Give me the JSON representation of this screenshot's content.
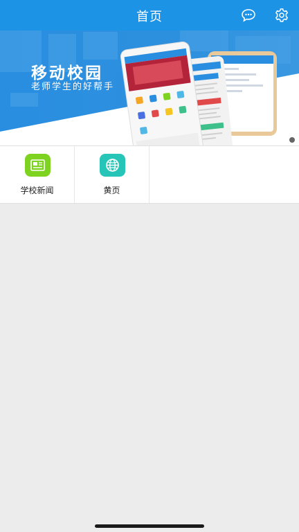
{
  "header": {
    "title": "首页",
    "chat_icon": "chat-bubble-icon",
    "settings_icon": "gear-icon"
  },
  "banner": {
    "title": "移动校园",
    "subtitle": "老师学生的好帮手",
    "image": "phone-app-mockup-illustration"
  },
  "quick_grid": {
    "items": [
      {
        "label": "学校新闻",
        "icon": "news-icon",
        "color": "#7ed321"
      },
      {
        "label": "黄页",
        "icon": "globe-icon",
        "color": "#26c5b8"
      }
    ]
  },
  "colors": {
    "header_bg": "#1d93e6",
    "banner_blue": "#1e8fe0",
    "page_bg": "#ececec"
  }
}
